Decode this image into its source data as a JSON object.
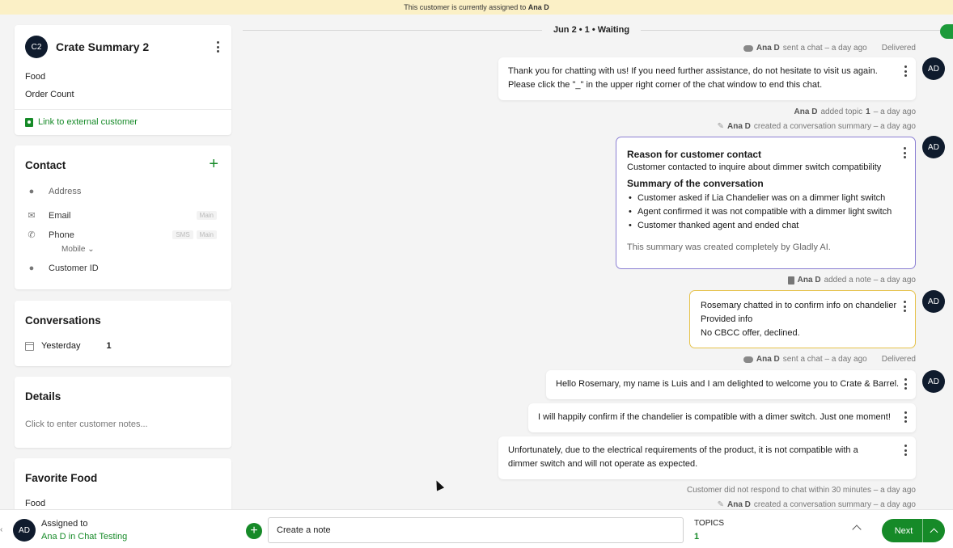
{
  "banner": {
    "prefix": "This customer is currently assigned to",
    "agent": "Ana D"
  },
  "customer_card": {
    "initials": "C2",
    "name": "Crate Summary 2",
    "fields": [
      "Food",
      "Order Count"
    ],
    "link_label": "Link to external customer"
  },
  "contact": {
    "title": "Contact",
    "address_label": "Address",
    "email_label": "Email",
    "email_tag": "Main",
    "phone_label": "Phone",
    "phone_tags": [
      "SMS",
      "Main"
    ],
    "phone_type": "Mobile ⌄",
    "customer_id_label": "Customer ID"
  },
  "conversations": {
    "title": "Conversations",
    "row_label": "Yesterday",
    "row_count": "1"
  },
  "details": {
    "title": "Details",
    "placeholder": "Click to enter customer notes..."
  },
  "favorite_food": {
    "title": "Favorite Food",
    "value": "Food"
  },
  "feed": {
    "date_separator": "Jun 2 • 1 • Waiting",
    "agent_initials": "AD",
    "meta1": {
      "agent": "Ana D",
      "text": "sent a chat – a day ago",
      "status": "Delivered"
    },
    "msg1": [
      "Thank you for chatting with us! If you need further assistance, do not hesitate to visit us again.",
      "Please click the \"_\" in the upper right corner of the chat window to end this chat."
    ],
    "meta2": {
      "agent": "Ana D",
      "text_pre": "added topic",
      "topic": "1",
      "text_post": "– a day ago"
    },
    "meta3": {
      "agent": "Ana D",
      "text": "created a conversation summary – a day ago"
    },
    "summary": {
      "heading1": "Reason for customer contact",
      "reason": "Customer contacted to inquire about dimmer switch compatibility",
      "heading2": "Summary of the conversation",
      "bullets": [
        "Customer asked if Lia Chandelier was on a dimmer light switch",
        "Agent confirmed it was not compatible with a dimmer light switch",
        "Customer thanked agent and ended chat"
      ],
      "footer": "This summary was created completely by Gladly AI."
    },
    "meta4": {
      "agent": "Ana D",
      "text": "added a note – a day ago"
    },
    "note": [
      "Rosemary chatted in to confirm info on chandelier",
      "Provided info",
      "No CBCC offer, declined."
    ],
    "meta5": {
      "agent": "Ana D",
      "text": "sent a chat – a day ago",
      "status": "Delivered"
    },
    "msg2": "Hello Rosemary, my name is Luis and I am delighted to welcome you to Crate & Barrel.",
    "msg3": "I will happily confirm if the chandelier is compatible with a dimer switch. Just one moment!",
    "msg4": [
      "Unfortunately, due to the electrical requirements of the product, it is not compatible with a",
      "dimmer switch and will not operate as expected."
    ],
    "meta6": "Customer did not respond to chat within 30 minutes – a day ago",
    "meta7": {
      "agent": "Ana D",
      "text": "created a conversation summary – a day ago"
    }
  },
  "footer": {
    "agent_initials": "AD",
    "assigned_label": "Assigned to",
    "assigned_value": "Ana D in Chat Testing",
    "note_placeholder": "Create a note",
    "topics_label": "TOPICS",
    "topics_value": "1",
    "next_label": "Next"
  },
  "colors": {
    "accent_green": "#168a28",
    "summary_border": "#8b7fd3",
    "note_border": "#e6c24a",
    "banner_bg": "#fbf0c6"
  },
  "icons": [
    "kebab-icon",
    "link-icon",
    "plus-icon",
    "location-icon",
    "email-icon",
    "phone-icon",
    "person-icon",
    "calendar-icon",
    "chat-bubble-icon",
    "pen-icon",
    "note-icon",
    "chevron-up-icon"
  ]
}
